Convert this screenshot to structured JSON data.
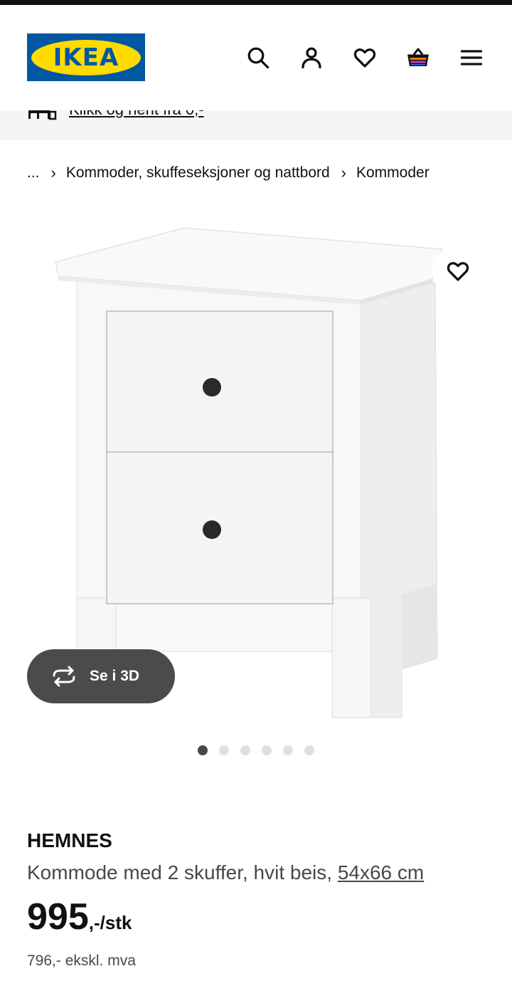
{
  "brand": {
    "logo_text": "IKEA",
    "colors": {
      "blue": "#0058a3",
      "yellow": "#ffdb00"
    }
  },
  "header": {
    "icons": [
      "search-icon",
      "account-icon",
      "favourites-icon",
      "cart-icon",
      "menu-icon"
    ]
  },
  "notice": {
    "text": "Klikk og hent fra 0,-",
    "icon": "store-pickup-icon"
  },
  "breadcrumb": {
    "ellipsis": "...",
    "items": [
      "Kommoder, skuffeseksjoner og nattbord",
      "Kommoder"
    ]
  },
  "gallery": {
    "see_3d_label": "Se i 3D",
    "image_count": 6,
    "active_index": 0
  },
  "product": {
    "name": "HEMNES",
    "description": "Kommode med 2 skuffer, hvit beis, ",
    "dimensions": "54x66 cm",
    "price_integer": "995",
    "price_suffix": ",-/stk",
    "price_ex_vat": "796,- ekskl. mva"
  }
}
